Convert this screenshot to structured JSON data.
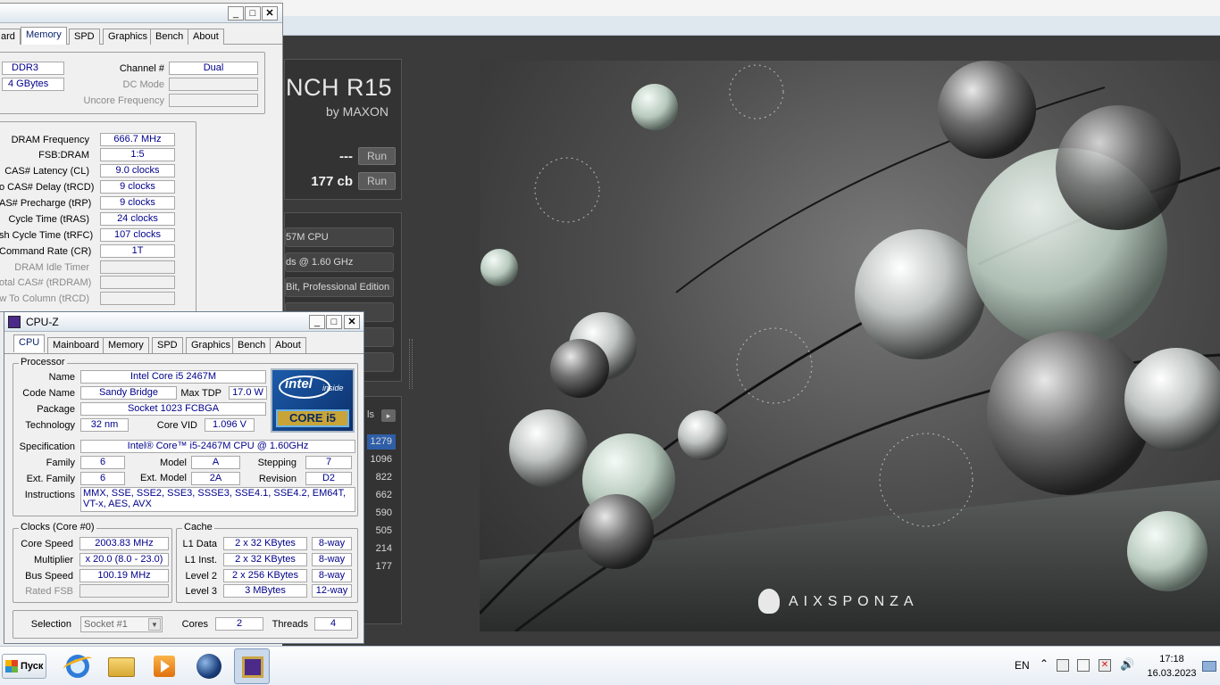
{
  "cinebench": {
    "title": "NCH R15",
    "subtitle": "by MAXON",
    "results": [
      {
        "value": "---",
        "run_label": "Run"
      },
      {
        "value": "177 cb",
        "run_label": "Run"
      }
    ],
    "system_rows": [
      "57M CPU",
      "ds @ 1.60 GHz",
      "Bit, Professional Edition",
      "",
      "",
      ""
    ],
    "ranking_label": "ls",
    "ranking_values": [
      "1279",
      "1096",
      "822",
      "662",
      "590",
      "505",
      "214",
      "177"
    ],
    "render_brand": "AIXSPONZA"
  },
  "cpuz_memory": {
    "tabs": [
      "ard",
      "Memory",
      "SPD",
      "Graphics",
      "Bench",
      "About"
    ],
    "active_tab": "Memory",
    "general": {
      "type_value": "DDR3",
      "size_value": "4 GBytes",
      "channel_label": "Channel #",
      "channel_value": "Dual",
      "dcmode_label": "DC Mode",
      "dcmode_value": "",
      "uncore_label": "Uncore Frequency",
      "uncore_value": ""
    },
    "timings": [
      {
        "label": "DRAM Frequency",
        "value": "666.7 MHz",
        "dim": false
      },
      {
        "label": "FSB:DRAM",
        "value": "1:5",
        "dim": false
      },
      {
        "label": "CAS# Latency (CL)",
        "value": "9.0 clocks",
        "dim": false
      },
      {
        "label": "o CAS# Delay (tRCD)",
        "value": "9 clocks",
        "dim": false
      },
      {
        "label": "AS# Precharge (tRP)",
        "value": "9 clocks",
        "dim": false
      },
      {
        "label": "Cycle Time (tRAS)",
        "value": "24 clocks",
        "dim": false
      },
      {
        "label": "sh Cycle Time (tRFC)",
        "value": "107 clocks",
        "dim": false
      },
      {
        "label": "Command Rate (CR)",
        "value": "1T",
        "dim": false
      },
      {
        "label": "DRAM Idle Timer",
        "value": "",
        "dim": true
      },
      {
        "label": "otal CAS# (tRDRAM)",
        "value": "",
        "dim": true
      },
      {
        "label": "w To Column (tRCD)",
        "value": "",
        "dim": true
      }
    ]
  },
  "cpuz_cpu": {
    "title": "CPU-Z",
    "tabs": [
      "CPU",
      "Mainboard",
      "Memory",
      "SPD",
      "Graphics",
      "Bench",
      "About"
    ],
    "active_tab": "CPU",
    "processor_group": "Processor",
    "name_label": "Name",
    "name_value": "Intel Core i5 2467M",
    "codename_label": "Code Name",
    "codename_value": "Sandy Bridge",
    "maxtdp_label": "Max TDP",
    "maxtdp_value": "17.0 W",
    "package_label": "Package",
    "package_value": "Socket 1023 FCBGA",
    "technology_label": "Technology",
    "technology_value": "32 nm",
    "corevid_label": "Core VID",
    "corevid_value": "1.096 V",
    "spec_label": "Specification",
    "spec_value": "Intel® Core™ i5-2467M CPU @ 1.60GHz",
    "family_label": "Family",
    "family_value": "6",
    "model_label": "Model",
    "model_value": "A",
    "stepping_label": "Stepping",
    "stepping_value": "7",
    "extfamily_label": "Ext. Family",
    "extfamily_value": "6",
    "extmodel_label": "Ext. Model",
    "extmodel_value": "2A",
    "revision_label": "Revision",
    "revision_value": "D2",
    "instructions_label": "Instructions",
    "instructions_value": "MMX, SSE, SSE2, SSE3, SSSE3, SSE4.1, SSE4.2, EM64T, VT-x, AES, AVX",
    "intel_logo_top": "intel",
    "intel_logo_inside": "inside",
    "intel_logo_bottom": "CORE i5",
    "clocks_group": "Clocks (Core #0)",
    "corespeed_label": "Core Speed",
    "corespeed_value": "2003.83 MHz",
    "multiplier_label": "Multiplier",
    "multiplier_value": "x 20.0 (8.0 - 23.0)",
    "busspeed_label": "Bus Speed",
    "busspeed_value": "100.19 MHz",
    "ratedfsb_label": "Rated FSB",
    "ratedfsb_value": "",
    "cache_group": "Cache",
    "cache_rows": [
      {
        "label": "L1 Data",
        "size": "2 x 32 KBytes",
        "ways": "8-way"
      },
      {
        "label": "L1 Inst.",
        "size": "2 x 32 KBytes",
        "ways": "8-way"
      },
      {
        "label": "Level 2",
        "size": "2 x 256 KBytes",
        "ways": "8-way"
      },
      {
        "label": "Level 3",
        "size": "3 MBytes",
        "ways": "12-way"
      }
    ],
    "selection_label": "Selection",
    "selection_value": "Socket #1",
    "cores_label": "Cores",
    "cores_value": "2",
    "threads_label": "Threads",
    "threads_value": "4"
  },
  "taskbar": {
    "start_label": "Пуск",
    "language": "EN",
    "time": "17:18",
    "date": "16.03.2023"
  }
}
